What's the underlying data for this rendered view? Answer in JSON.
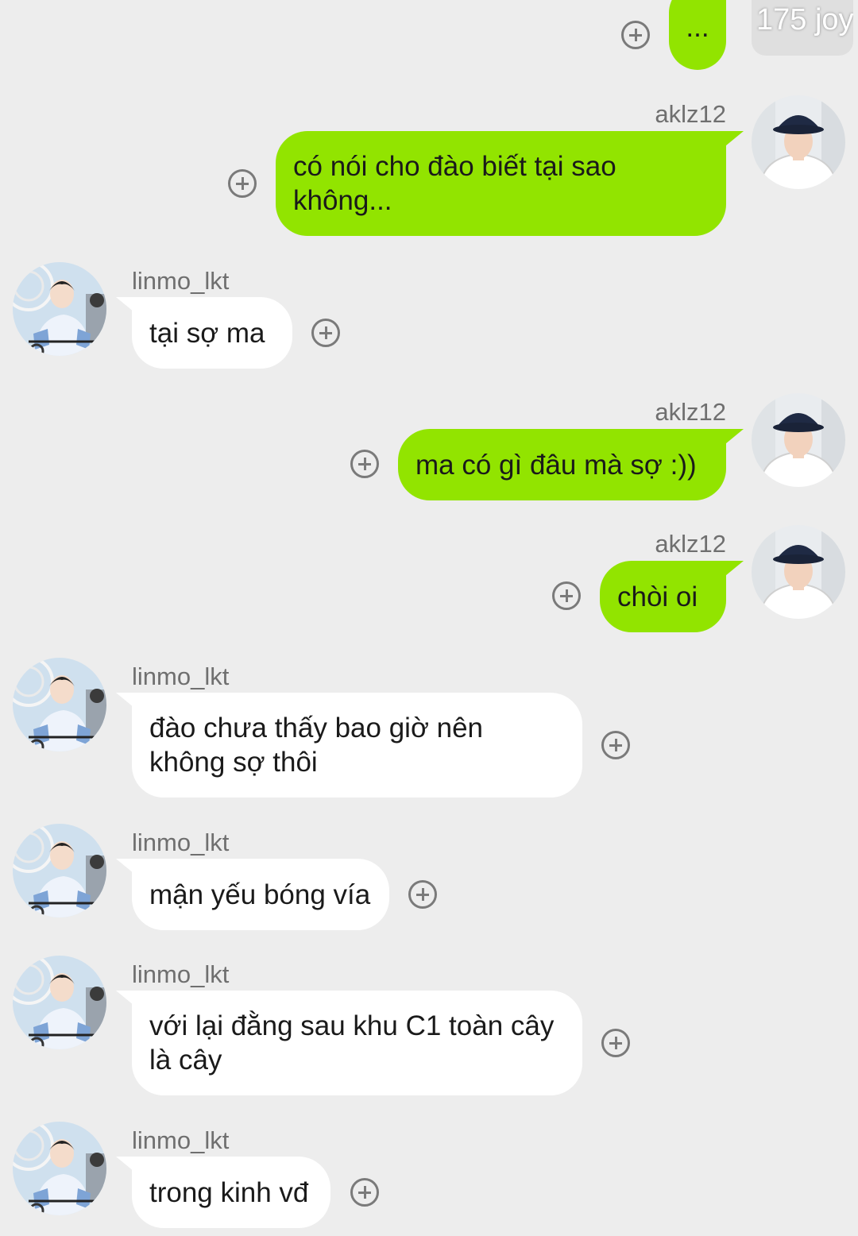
{
  "watermark": "175 joy",
  "colors": {
    "background": "#ededed",
    "my_bubble": "#92e400",
    "their_bubble": "#ffffff"
  },
  "messages": [
    {
      "sender": "",
      "text": "...",
      "side": "right"
    },
    {
      "sender": "aklz12",
      "text": "có nói cho đào biết tại sao\nkhông...",
      "side": "right"
    },
    {
      "sender": "linmo_lkt",
      "text": "tại sợ ma",
      "side": "left"
    },
    {
      "sender": "aklz12",
      "text": "ma có gì đâu mà sợ :))",
      "side": "right"
    },
    {
      "sender": "aklz12",
      "text": "chòi oi",
      "side": "right"
    },
    {
      "sender": "linmo_lkt",
      "text": "đào chưa thấy bao giờ nên\nkhông sợ thôi",
      "side": "left"
    },
    {
      "sender": "linmo_lkt",
      "text": "mận yếu bóng vía",
      "side": "left"
    },
    {
      "sender": "linmo_lkt",
      "text": "với lại đằng sau khu C1 toàn cây\nlà cây",
      "side": "left"
    },
    {
      "sender": "linmo_lkt",
      "text": "trong kinh vđ",
      "side": "left"
    }
  ]
}
